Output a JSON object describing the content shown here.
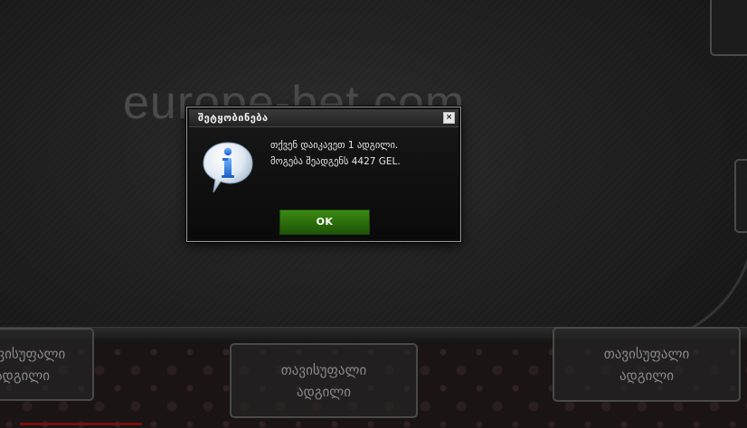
{
  "background": {
    "watermark_text": "europe-bet.com"
  },
  "seats": [
    {
      "label_line1": "თავისუფალი",
      "label_line2": "ადგილი"
    },
    {
      "label_line1": "თავისუფალი",
      "label_line2": "ადგილი"
    },
    {
      "label_line1": "თავისუფალი",
      "label_line2": "ადგილი"
    }
  ],
  "dialog": {
    "title": "შეტყობინება",
    "close_glyph": "×",
    "icon": "info-speech-bubble-icon",
    "message_line1": "თქვენ დაიკავეთ 1 ადგილი.",
    "message_line2": "მოგება შეადგენს 4427 GEL.",
    "ok_label": "OK"
  },
  "colors": {
    "ok_button": "#2b6e0b",
    "dialog_border": "#9a9a9a",
    "seat_border": "#4a4a4a"
  }
}
